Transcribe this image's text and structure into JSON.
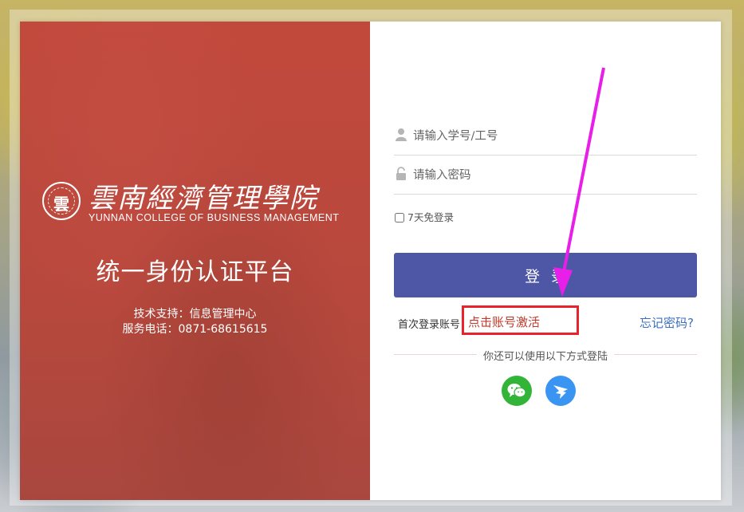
{
  "brand": {
    "seal_glyph": "雲",
    "name_cn": "雲南經濟管理學院",
    "name_en": "YUNNAN COLLEGE OF BUSINESS MANAGEMENT"
  },
  "platform_title": "统一身份认证平台",
  "support": {
    "tech_support": "技术支持：信息管理中心",
    "phone": "服务电话：0871-68615615"
  },
  "form": {
    "username_placeholder": "请输入学号/工号",
    "password_placeholder": "请输入密码",
    "remember_label": "7天免登录",
    "login_label": "登录",
    "first_login_text": "首次登录账号",
    "activate_label": "点击账号激活",
    "forgot_label": "忘记密码?",
    "other_methods": "你还可以使用以下方式登陆"
  },
  "social": [
    {
      "name": "wechat-icon",
      "color": "#32b439"
    },
    {
      "name": "dingtalk-icon",
      "color": "#3a95f2"
    }
  ],
  "colors": {
    "left_panel": "#b8483d",
    "login_button": "#4e56a6",
    "highlight_box": "#e8232a",
    "annotation_arrow": "#e81fe8",
    "link": "#3d6fbf"
  }
}
